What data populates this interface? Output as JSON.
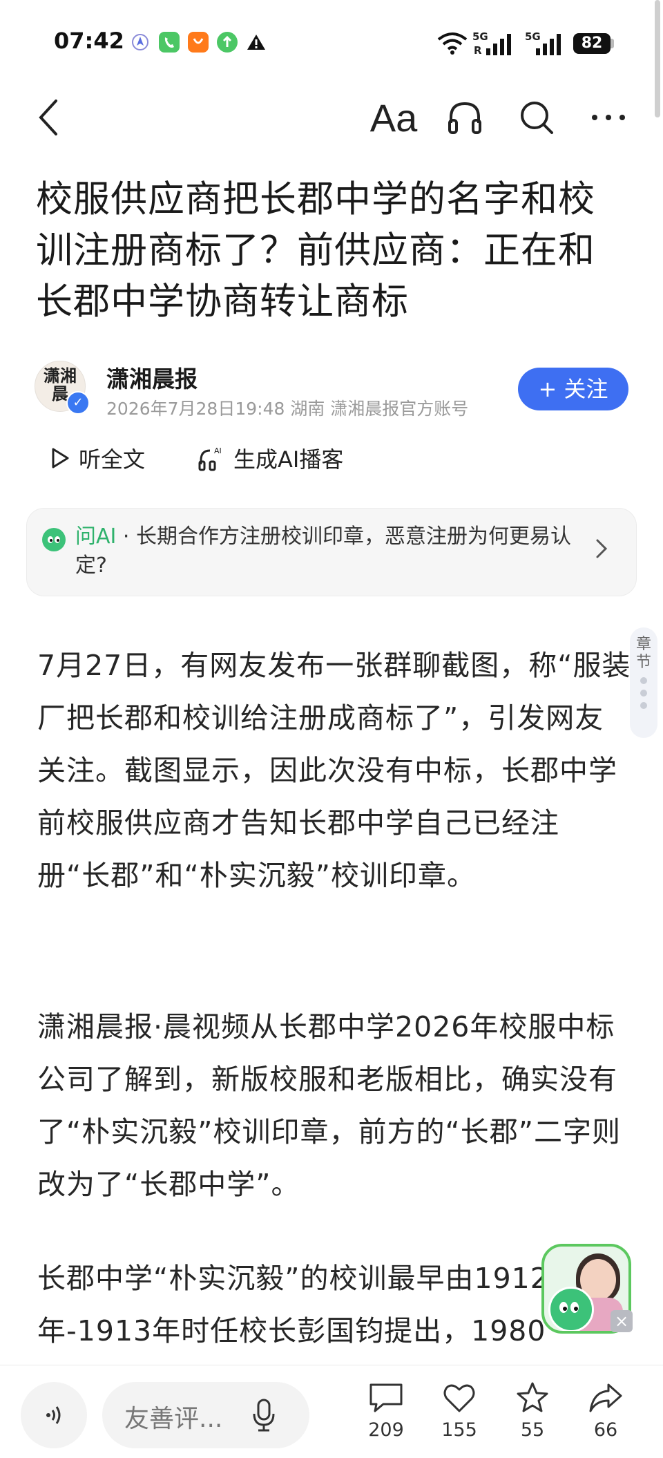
{
  "status_bar": {
    "time": "07:42",
    "battery": "82",
    "signal_labels": [
      "5G",
      "5G"
    ],
    "app_icons": [
      "navigation-icon",
      "phone-icon",
      "taobao-icon",
      "upload-icon",
      "warning-icon"
    ]
  },
  "toolbar": {
    "font_label": "Aa",
    "icons": [
      "back-icon",
      "font-size-icon",
      "headphones-icon",
      "search-icon",
      "more-icon"
    ]
  },
  "article": {
    "title": "校服供应商把长郡中学的名字和校训注册商标了？前供应商：正在和长郡中学协商转让商标",
    "author": {
      "avatar_text": "潇湘晨",
      "name": "潇湘晨报",
      "meta": "2026年7月28日19:48 湖南 潇湘晨报官方账号",
      "follow_label": "+ 关注"
    },
    "listen_label": "听全文",
    "ai_podcast_label": "生成AI播客",
    "ai_card": {
      "tag": "问AI",
      "text": " · 长期合作方注册校训印章，恶意注册为何更易认定?"
    },
    "chapter_label": "章节",
    "paragraphs": [
      "7月27日，有网友发布一张群聊截图，称“服装厂把长郡和校训给注册成商标了”，引发网友关注。截图显示，因此次没有中标，长郡中学前校服供应商才告知长郡中学自己已经注册“长郡”和“朴实沉毅”校训印章。",
      "潇湘晨报·晨视频从长郡中学2026年校服中标公司了解到，新版校服和老版相比，确实没有了“朴实沉毅”校训印章，前方的“长郡”二字则改为了“长郡中学”。",
      "长郡中学“朴实沉毅”的校训最早由1912年-1913年时任校长彭国钧提出，1980"
    ]
  },
  "bottom_bar": {
    "comment_placeholder": "友善评...",
    "comments": "209",
    "likes": "155",
    "favorites": "55",
    "shares": "66"
  },
  "colors": {
    "accent_blue": "#3e6ff2",
    "ai_green": "#2fb26c"
  }
}
